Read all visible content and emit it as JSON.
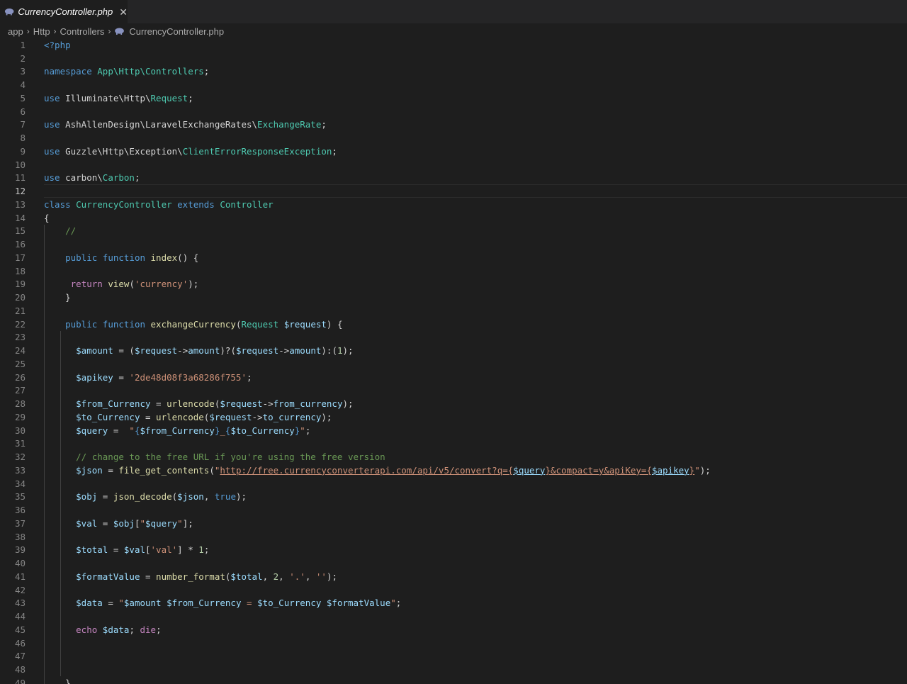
{
  "tab": {
    "label": "CurrencyController.php"
  },
  "breadcrumb": {
    "items": [
      "app",
      "Http",
      "Controllers",
      "CurrencyController.php"
    ]
  },
  "colors": {
    "keyword": "#569cd6",
    "control": "#c586c0",
    "type": "#4ec9b0",
    "function": "#dcdcaa",
    "variable": "#9cdcfe",
    "string": "#ce9178",
    "comment": "#6a9955",
    "number": "#b5cea8",
    "plain": "#d4d4d4"
  },
  "editor": {
    "current_line": 12,
    "lines": [
      {
        "n": "1",
        "t": [
          [
            "kw",
            "<?php"
          ]
        ]
      },
      {
        "n": "2",
        "t": []
      },
      {
        "n": "3",
        "t": [
          [
            "kw",
            "namespace "
          ],
          [
            "ty",
            "App\\Http\\Controllers"
          ],
          [
            "pl",
            ";"
          ]
        ]
      },
      {
        "n": "4",
        "t": []
      },
      {
        "n": "5",
        "t": [
          [
            "kw",
            "use "
          ],
          [
            "pl",
            "Illuminate\\Http\\"
          ],
          [
            "ty",
            "Request"
          ],
          [
            "pl",
            ";"
          ]
        ]
      },
      {
        "n": "6",
        "t": []
      },
      {
        "n": "7",
        "t": [
          [
            "kw",
            "use "
          ],
          [
            "pl",
            "AshAllenDesign\\LaravelExchangeRates\\"
          ],
          [
            "ty",
            "ExchangeRate"
          ],
          [
            "pl",
            ";"
          ]
        ]
      },
      {
        "n": "8",
        "t": []
      },
      {
        "n": "9",
        "t": [
          [
            "kw",
            "use "
          ],
          [
            "pl",
            "Guzzle\\Http\\Exception\\"
          ],
          [
            "ty",
            "ClientErrorResponseException"
          ],
          [
            "pl",
            ";"
          ]
        ]
      },
      {
        "n": "10",
        "t": []
      },
      {
        "n": "11",
        "t": [
          [
            "kw",
            "use "
          ],
          [
            "pl",
            "carbon\\"
          ],
          [
            "ty",
            "Carbon"
          ],
          [
            "pl",
            ";"
          ]
        ]
      },
      {
        "n": "12",
        "t": []
      },
      {
        "n": "13",
        "t": [
          [
            "kw",
            "class "
          ],
          [
            "ty",
            "CurrencyController "
          ],
          [
            "kw",
            "extends "
          ],
          [
            "ty",
            "Controller"
          ]
        ]
      },
      {
        "n": "14",
        "t": [
          [
            "pl",
            "{"
          ]
        ]
      },
      {
        "n": "15",
        "t": [
          [
            "pl",
            "    "
          ],
          [
            "cmt",
            "//"
          ]
        ]
      },
      {
        "n": "16",
        "t": []
      },
      {
        "n": "17",
        "t": [
          [
            "pl",
            "    "
          ],
          [
            "kw",
            "public function "
          ],
          [
            "fn",
            "index"
          ],
          [
            "pl",
            "() {"
          ]
        ]
      },
      {
        "n": "18",
        "t": []
      },
      {
        "n": "19",
        "t": [
          [
            "pl",
            "     "
          ],
          [
            "ctl",
            "return "
          ],
          [
            "fn",
            "view"
          ],
          [
            "pl",
            "("
          ],
          [
            "str",
            "'currency'"
          ],
          [
            "pl",
            ");"
          ]
        ]
      },
      {
        "n": "20",
        "t": [
          [
            "pl",
            "    }"
          ]
        ]
      },
      {
        "n": "21",
        "t": []
      },
      {
        "n": "22",
        "t": [
          [
            "pl",
            "    "
          ],
          [
            "kw",
            "public function "
          ],
          [
            "fn",
            "exchangeCurrency"
          ],
          [
            "pl",
            "("
          ],
          [
            "ty",
            "Request "
          ],
          [
            "var",
            "$request"
          ],
          [
            "pl",
            ") {"
          ]
        ]
      },
      {
        "n": "23",
        "t": []
      },
      {
        "n": "24",
        "t": [
          [
            "pl",
            "      "
          ],
          [
            "var",
            "$amount"
          ],
          [
            "pl",
            " = ("
          ],
          [
            "var",
            "$request"
          ],
          [
            "pl",
            "->"
          ],
          [
            "var",
            "amount"
          ],
          [
            "pl",
            ")?("
          ],
          [
            "var",
            "$request"
          ],
          [
            "pl",
            "->"
          ],
          [
            "var",
            "amount"
          ],
          [
            "pl",
            "):("
          ],
          [
            "num",
            "1"
          ],
          [
            "pl",
            ");"
          ]
        ]
      },
      {
        "n": "25",
        "t": []
      },
      {
        "n": "26",
        "t": [
          [
            "pl",
            "      "
          ],
          [
            "var",
            "$apikey"
          ],
          [
            "pl",
            " = "
          ],
          [
            "str",
            "'2de48d08f3a68286f755'"
          ],
          [
            "pl",
            ";"
          ]
        ]
      },
      {
        "n": "27",
        "t": []
      },
      {
        "n": "28",
        "t": [
          [
            "pl",
            "      "
          ],
          [
            "var",
            "$from_Currency"
          ],
          [
            "pl",
            " = "
          ],
          [
            "fn",
            "urlencode"
          ],
          [
            "pl",
            "("
          ],
          [
            "var",
            "$request"
          ],
          [
            "pl",
            "->"
          ],
          [
            "var",
            "from_currency"
          ],
          [
            "pl",
            ");"
          ]
        ]
      },
      {
        "n": "29",
        "t": [
          [
            "pl",
            "      "
          ],
          [
            "var",
            "$to_Currency"
          ],
          [
            "pl",
            " = "
          ],
          [
            "fn",
            "urlencode"
          ],
          [
            "pl",
            "("
          ],
          [
            "var",
            "$request"
          ],
          [
            "pl",
            "->"
          ],
          [
            "var",
            "to_currency"
          ],
          [
            "pl",
            ");"
          ]
        ]
      },
      {
        "n": "30",
        "t": [
          [
            "pl",
            "      "
          ],
          [
            "var",
            "$query"
          ],
          [
            "pl",
            " =  "
          ],
          [
            "str",
            "\""
          ],
          [
            "brace",
            "{"
          ],
          [
            "var",
            "$from_Currency"
          ],
          [
            "brace",
            "}"
          ],
          [
            "str",
            "_"
          ],
          [
            "brace",
            "{"
          ],
          [
            "var",
            "$to_Currency"
          ],
          [
            "brace",
            "}"
          ],
          [
            "str",
            "\""
          ],
          [
            "pl",
            ";"
          ]
        ]
      },
      {
        "n": "31",
        "t": []
      },
      {
        "n": "32",
        "t": [
          [
            "pl",
            "      "
          ],
          [
            "cmt",
            "// change to the free URL if you're using the free version"
          ]
        ]
      },
      {
        "n": "33",
        "t": [
          [
            "pl",
            "      "
          ],
          [
            "var",
            "$json"
          ],
          [
            "pl",
            " = "
          ],
          [
            "fn",
            "file_get_contents"
          ],
          [
            "pl",
            "("
          ],
          [
            "str",
            "\""
          ],
          [
            "url",
            "http://free.currencyconverterapi.com/api/v5/convert?q={"
          ],
          [
            "interp",
            "$query"
          ],
          [
            "url",
            "}&compact=y&apiKey={"
          ],
          [
            "interp",
            "$apikey"
          ],
          [
            "url",
            "}"
          ],
          [
            "str",
            "\""
          ],
          [
            "pl",
            ");"
          ]
        ]
      },
      {
        "n": "34",
        "t": []
      },
      {
        "n": "35",
        "t": [
          [
            "pl",
            "      "
          ],
          [
            "var",
            "$obj"
          ],
          [
            "pl",
            " = "
          ],
          [
            "fn",
            "json_decode"
          ],
          [
            "pl",
            "("
          ],
          [
            "var",
            "$json"
          ],
          [
            "pl",
            ", "
          ],
          [
            "kw",
            "true"
          ],
          [
            "pl",
            ");"
          ]
        ]
      },
      {
        "n": "36",
        "t": []
      },
      {
        "n": "37",
        "t": [
          [
            "pl",
            "      "
          ],
          [
            "var",
            "$val"
          ],
          [
            "pl",
            " = "
          ],
          [
            "var",
            "$obj"
          ],
          [
            "pl",
            "["
          ],
          [
            "str",
            "\""
          ],
          [
            "var",
            "$query"
          ],
          [
            "str",
            "\""
          ],
          [
            "pl",
            "];"
          ]
        ]
      },
      {
        "n": "38",
        "t": []
      },
      {
        "n": "39",
        "t": [
          [
            "pl",
            "      "
          ],
          [
            "var",
            "$total"
          ],
          [
            "pl",
            " = "
          ],
          [
            "var",
            "$val"
          ],
          [
            "pl",
            "["
          ],
          [
            "str",
            "'val'"
          ],
          [
            "pl",
            "] * "
          ],
          [
            "num",
            "1"
          ],
          [
            "pl",
            ";"
          ]
        ]
      },
      {
        "n": "40",
        "t": []
      },
      {
        "n": "41",
        "t": [
          [
            "pl",
            "      "
          ],
          [
            "var",
            "$formatValue"
          ],
          [
            "pl",
            " = "
          ],
          [
            "fn",
            "number_format"
          ],
          [
            "pl",
            "("
          ],
          [
            "var",
            "$total"
          ],
          [
            "pl",
            ", "
          ],
          [
            "num",
            "2"
          ],
          [
            "pl",
            ", "
          ],
          [
            "str",
            "'.'"
          ],
          [
            "pl",
            ", "
          ],
          [
            "str",
            "''"
          ],
          [
            "pl",
            ");"
          ]
        ]
      },
      {
        "n": "42",
        "t": []
      },
      {
        "n": "43",
        "t": [
          [
            "pl",
            "      "
          ],
          [
            "var",
            "$data"
          ],
          [
            "pl",
            " = "
          ],
          [
            "str",
            "\""
          ],
          [
            "var",
            "$amount"
          ],
          [
            "str",
            " "
          ],
          [
            "var",
            "$from_Currency"
          ],
          [
            "str",
            " = "
          ],
          [
            "var",
            "$to_Currency"
          ],
          [
            "str",
            " "
          ],
          [
            "var",
            "$formatValue"
          ],
          [
            "str",
            "\""
          ],
          [
            "pl",
            ";"
          ]
        ]
      },
      {
        "n": "44",
        "t": []
      },
      {
        "n": "45",
        "t": [
          [
            "pl",
            "      "
          ],
          [
            "ctl",
            "echo "
          ],
          [
            "var",
            "$data"
          ],
          [
            "pl",
            "; "
          ],
          [
            "ctl",
            "die"
          ],
          [
            "pl",
            ";"
          ]
        ]
      },
      {
        "n": "46",
        "t": []
      },
      {
        "n": "47",
        "t": []
      },
      {
        "n": "48",
        "t": []
      },
      {
        "n": "49",
        "t": [
          [
            "pl",
            "    }"
          ]
        ]
      }
    ]
  }
}
